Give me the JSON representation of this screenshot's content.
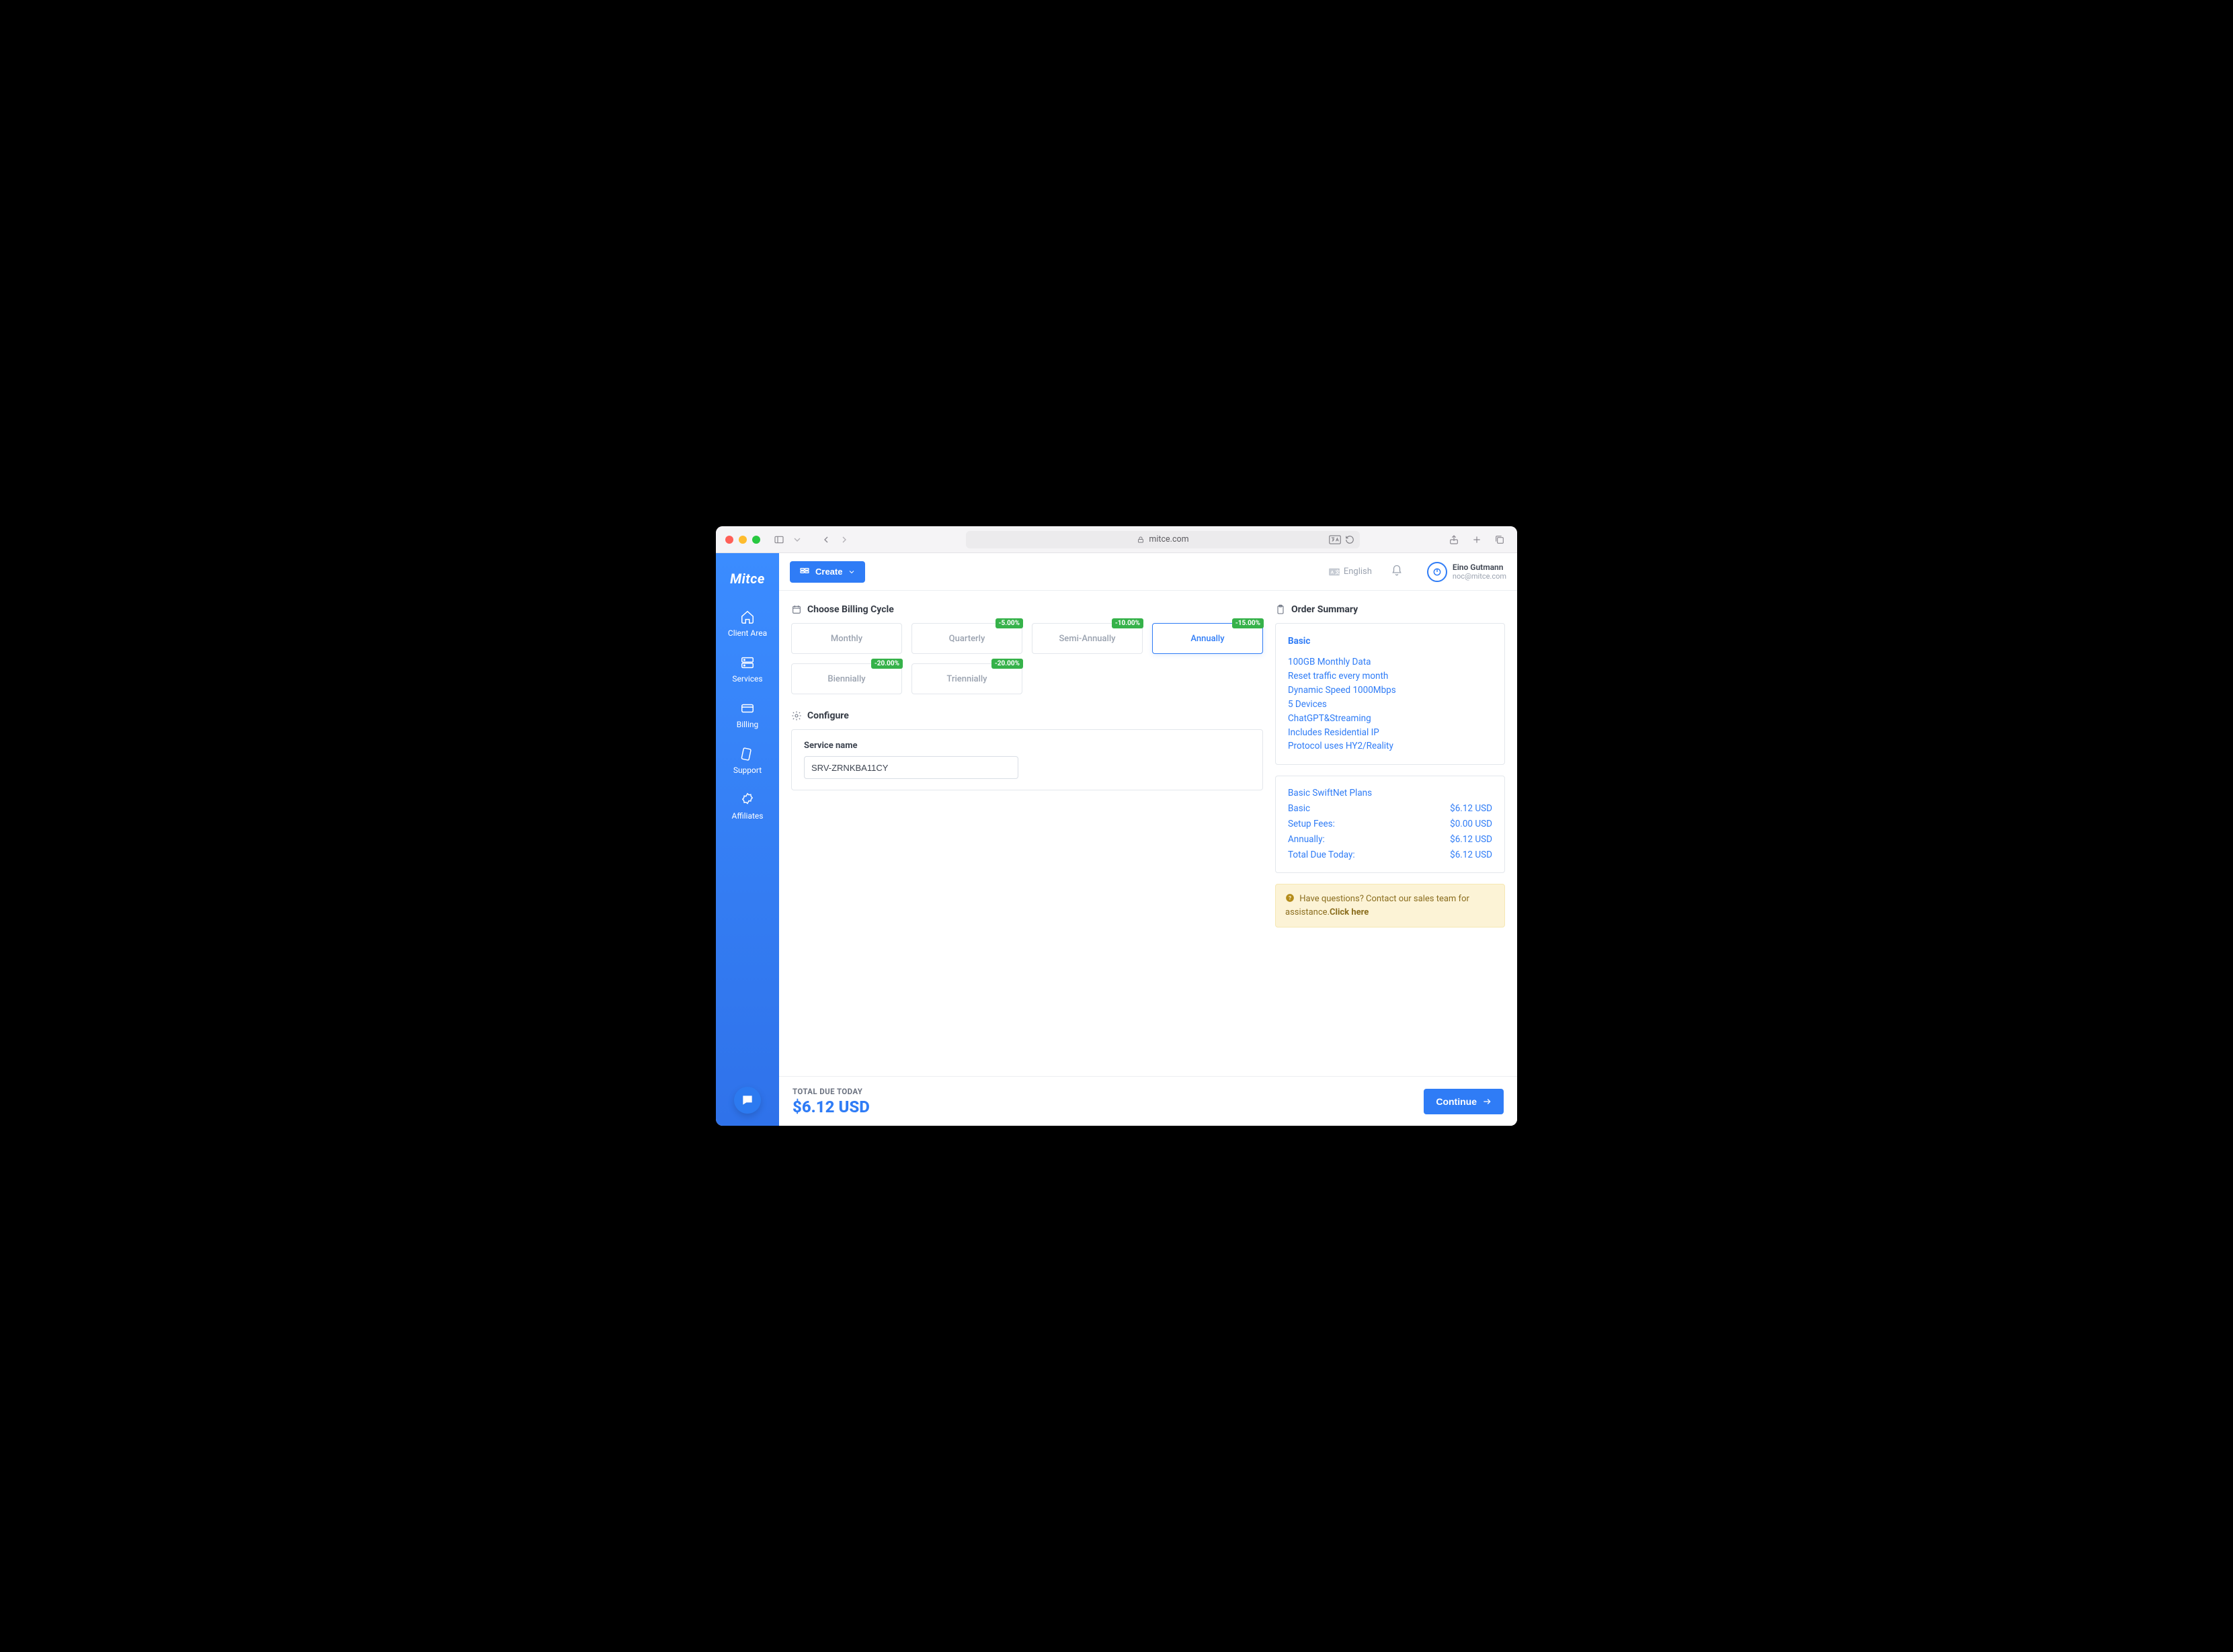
{
  "browser": {
    "domain": "mitce.com"
  },
  "brand": "Mitce",
  "sidebar": {
    "items": [
      {
        "label": "Client Area"
      },
      {
        "label": "Services"
      },
      {
        "label": "Billing"
      },
      {
        "label": "Support"
      },
      {
        "label": "Affiliates"
      }
    ]
  },
  "topbar": {
    "create_label": "Create",
    "language": "English",
    "user": {
      "name": "Eino Gutmann",
      "email": "noc@mitce.com"
    }
  },
  "sections": {
    "billing_cycle": "Choose Billing Cycle",
    "configure": "Configure",
    "order_summary": "Order Summary"
  },
  "cycles": [
    {
      "label": "Monthly",
      "discount": null,
      "selected": false
    },
    {
      "label": "Quarterly",
      "discount": "-5.00%",
      "selected": false
    },
    {
      "label": "Semi-Annually",
      "discount": "-10.00%",
      "selected": false
    },
    {
      "label": "Annually",
      "discount": "-15.00%",
      "selected": true
    },
    {
      "label": "Biennially",
      "discount": "-20.00%",
      "selected": false
    },
    {
      "label": "Triennially",
      "discount": "-20.00%",
      "selected": false
    }
  ],
  "configure": {
    "service_name_label": "Service name",
    "service_name_value": "SRV-ZRNKBA11CY"
  },
  "summary": {
    "plan": "Basic",
    "features": [
      "100GB Monthly Data",
      "Reset traffic every month",
      "Dynamic Speed 1000Mbps",
      "5 Devices",
      "ChatGPT&Streaming",
      "Includes Residential IP",
      "Protocol uses HY2/Reality"
    ]
  },
  "pricing": {
    "plan_group": "Basic SwiftNet Plans",
    "rows": [
      {
        "label": "Basic",
        "value": "$6.12 USD"
      },
      {
        "label": "Setup Fees:",
        "value": "$0.00 USD"
      },
      {
        "label": "Annually:",
        "value": "$6.12 USD"
      },
      {
        "label": "Total Due Today:",
        "value": "$6.12 USD"
      }
    ]
  },
  "notice": {
    "text": "Have questions? Contact our sales team for assistance.",
    "link": "Click here"
  },
  "footer": {
    "label": "TOTAL DUE TODAY",
    "amount": "$6.12 USD",
    "continue": "Continue"
  }
}
